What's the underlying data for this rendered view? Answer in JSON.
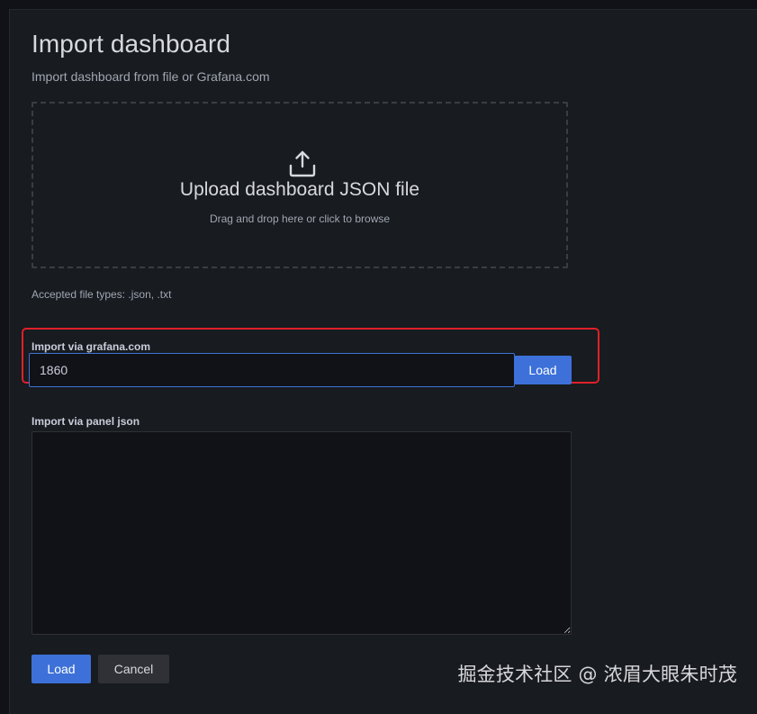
{
  "header": {
    "title": "Import dashboard",
    "subtitle": "Import dashboard from file or Grafana.com"
  },
  "upload": {
    "icon": "upload-icon",
    "title": "Upload dashboard JSON file",
    "hint": "Drag and drop here or click to browse",
    "accepted_types": "Accepted file types: .json, .txt"
  },
  "grafana_import": {
    "label": "Import via grafana.com",
    "value": "1860",
    "load_label": "Load"
  },
  "panel_json": {
    "label": "Import via panel json",
    "value": ""
  },
  "actions": {
    "load_label": "Load",
    "cancel_label": "Cancel"
  },
  "watermark": {
    "text": "掘金技术社区 @ 浓眉大眼朱时茂"
  },
  "colors": {
    "background": "#111217",
    "panel": "#181b1f",
    "primary": "#3d71d9",
    "highlight": "#e0202a",
    "secondary_button": "#2f3137"
  }
}
